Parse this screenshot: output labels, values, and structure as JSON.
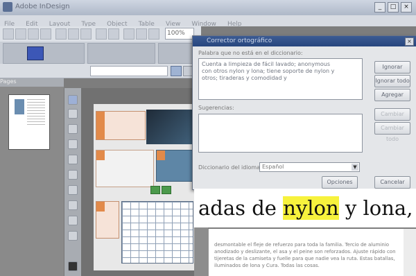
{
  "app": {
    "title": "Adobe InDesign",
    "window_controls": [
      "_",
      "□",
      "×"
    ]
  },
  "menu": [
    "File",
    "Edit",
    "Layout",
    "Type",
    "Object",
    "Table",
    "View",
    "Window",
    "Help"
  ],
  "toolbar": {
    "zoom": "100%"
  },
  "panel": {
    "title": "Pages"
  },
  "dialog": {
    "title": "Corrector ortográfico",
    "notfound_label": "Palabra que no está en el diccionario:",
    "notfound_text": "Cuenta a limpieza de fácil lavado; anonymous con otros nylon y lona; tiene soporte de nylon y otros; tiraderas y comodidad y",
    "suggestions_label": "Sugerencias:",
    "language_label": "Diccionario del idioma:",
    "language_value": "Español",
    "buttons": {
      "ignore": "Ignorar",
      "ignore_all": "Ignorar todo",
      "add": "Agregar",
      "change": "Cambiar",
      "change_all": "Cambiar todo",
      "options": "Opciones",
      "cancel": "Cancelar"
    }
  },
  "document": {
    "line_pre": "adas de ",
    "highlight": "nylon",
    "line_post": " y lona,",
    "paragraph": "desmontable el fleje de refuerzo para toda la familia. Tercio de aluminio anodizado y deslizante, el asa y el peine son reforzados. Ajuste rápido con tijeretas de la camiseta y fuelle para que nadie vea la ruta. Estas batallas, iluminados de lona y Cura. Todas las cosas."
  }
}
